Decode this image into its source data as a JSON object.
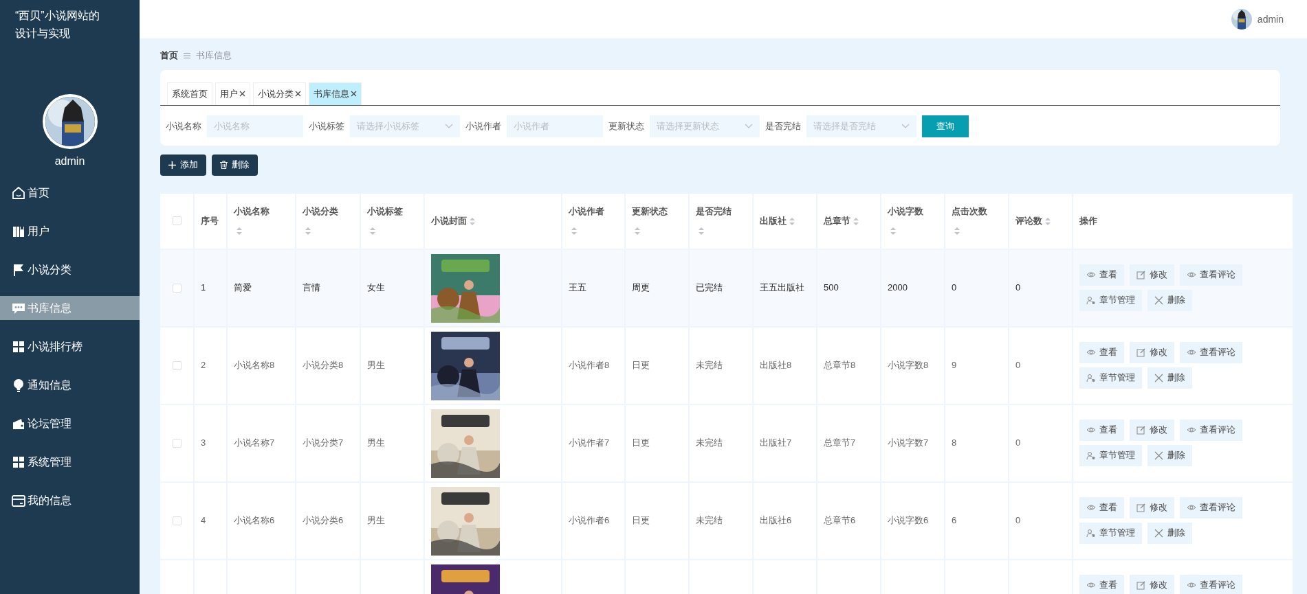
{
  "sidebar": {
    "title": "“西贝”小说网站的设计与实现",
    "user": "admin",
    "items": [
      {
        "label": "首页",
        "selected": false
      },
      {
        "label": "用户",
        "selected": false
      },
      {
        "label": "小说分类",
        "selected": false
      },
      {
        "label": "书库信息",
        "selected": true
      },
      {
        "label": "小说排行榜",
        "selected": false
      },
      {
        "label": "通知信息",
        "selected": false
      },
      {
        "label": "论坛管理",
        "selected": false
      },
      {
        "label": "系统管理",
        "selected": false
      },
      {
        "label": "我的信息",
        "selected": false
      }
    ]
  },
  "header": {
    "user": "admin"
  },
  "breadcrumb": [
    "首页",
    "书库信息"
  ],
  "tabs": [
    {
      "label": "系统首页",
      "closable": false,
      "selected": false
    },
    {
      "label": "用户",
      "closable": true,
      "selected": false
    },
    {
      "label": "小说分类",
      "closable": true,
      "selected": false
    },
    {
      "label": "书库信息",
      "closable": true,
      "selected": true
    }
  ],
  "filters": [
    {
      "label": "小说名称",
      "placeholder": "小说名称",
      "kind": "text"
    },
    {
      "label": "小说标签",
      "placeholder": "请选择小说标签",
      "kind": "select"
    },
    {
      "label": "小说作者",
      "placeholder": "小说作者",
      "kind": "text"
    },
    {
      "label": "更新状态",
      "placeholder": "请选择更新状态",
      "kind": "select"
    },
    {
      "label": "是否完结",
      "placeholder": "请选择是否完结",
      "kind": "select"
    }
  ],
  "search_button": "查询",
  "toolbar": [
    {
      "label": "添加",
      "kind": "add"
    },
    {
      "label": "删除",
      "kind": "delete"
    }
  ],
  "table": {
    "all_checked": false,
    "columns": [
      {
        "label": "序号",
        "sortable": false
      },
      {
        "label": "小说名称",
        "sortable": true
      },
      {
        "label": "小说分类",
        "sortable": true
      },
      {
        "label": "小说标签",
        "sortable": true
      },
      {
        "label": "小说封面",
        "sortable": true
      },
      {
        "label": "小说作者",
        "sortable": true
      },
      {
        "label": "更新状态",
        "sortable": true
      },
      {
        "label": "是否完结",
        "sortable": true
      },
      {
        "label": "出版社",
        "sortable": true
      },
      {
        "label": "总章节",
        "sortable": true
      },
      {
        "label": "小说字数",
        "sortable": true
      },
      {
        "label": "点击次数",
        "sortable": true
      },
      {
        "label": "评论数",
        "sortable": true
      },
      {
        "label": "操作",
        "sortable": false
      }
    ],
    "rows": [
      {
        "checked": false,
        "hovered": true,
        "cells": [
          "1",
          "简爱",
          "言情",
          "女生"
        ],
        "cover": {
          "kind": "picture"
        },
        "cells2": [
          "王五",
          "周更",
          "已完结",
          "王五出版社",
          "500",
          "2000",
          "0",
          "0"
        ],
        "actions": [
          {
            "label": "查看",
            "kind": "view"
          },
          {
            "label": "修改",
            "kind": "edit"
          },
          {
            "label": "查看评论",
            "kind": "view"
          },
          {
            "label": "章节管理",
            "kind": "chapters"
          },
          {
            "label": "删除",
            "kind": "delete"
          }
        ]
      },
      {
        "checked": false,
        "hovered": false,
        "cells": [
          "2",
          "小说名称8",
          "小说分类8",
          "男生"
        ],
        "cover": {
          "kind": "picture"
        },
        "cells2": [
          "小说作者8",
          "日更",
          "未完结",
          "出版社8",
          "总章节8",
          "小说字数8",
          "9",
          "0"
        ],
        "actions": [
          {
            "label": "查看",
            "kind": "view"
          },
          {
            "label": "修改",
            "kind": "edit"
          },
          {
            "label": "查看评论",
            "kind": "view"
          },
          {
            "label": "章节管理",
            "kind": "chapters"
          },
          {
            "label": "删除",
            "kind": "delete"
          }
        ]
      },
      {
        "checked": false,
        "hovered": false,
        "cells": [
          "3",
          "小说名称7",
          "小说分类7",
          "男生"
        ],
        "cover": {
          "kind": "picture"
        },
        "cells2": [
          "小说作者7",
          "日更",
          "未完结",
          "出版社7",
          "总章节7",
          "小说字数7",
          "8",
          "0"
        ],
        "actions": [
          {
            "label": "查看",
            "kind": "view"
          },
          {
            "label": "修改",
            "kind": "edit"
          },
          {
            "label": "查看评论",
            "kind": "view"
          },
          {
            "label": "章节管理",
            "kind": "chapters"
          },
          {
            "label": "删除",
            "kind": "delete"
          }
        ]
      },
      {
        "checked": false,
        "hovered": false,
        "cells": [
          "4",
          "小说名称6",
          "小说分类6",
          "男生"
        ],
        "cover": {
          "kind": "picture"
        },
        "cells2": [
          "小说作者6",
          "日更",
          "未完结",
          "出版社6",
          "总章节6",
          "小说字数6",
          "6",
          "0"
        ],
        "actions": [
          {
            "label": "查看",
            "kind": "view"
          },
          {
            "label": "修改",
            "kind": "edit"
          },
          {
            "label": "查看评论",
            "kind": "view"
          },
          {
            "label": "章节管理",
            "kind": "chapters"
          },
          {
            "label": "删除",
            "kind": "delete"
          }
        ]
      },
      {
        "cover": {
          "kind": "picture"
        },
        "actions": [
          {
            "label": "查看",
            "kind": "view"
          },
          {
            "label": "修改",
            "kind": "edit"
          },
          {
            "label": "查看评论",
            "kind": "view"
          }
        ]
      }
    ]
  }
}
